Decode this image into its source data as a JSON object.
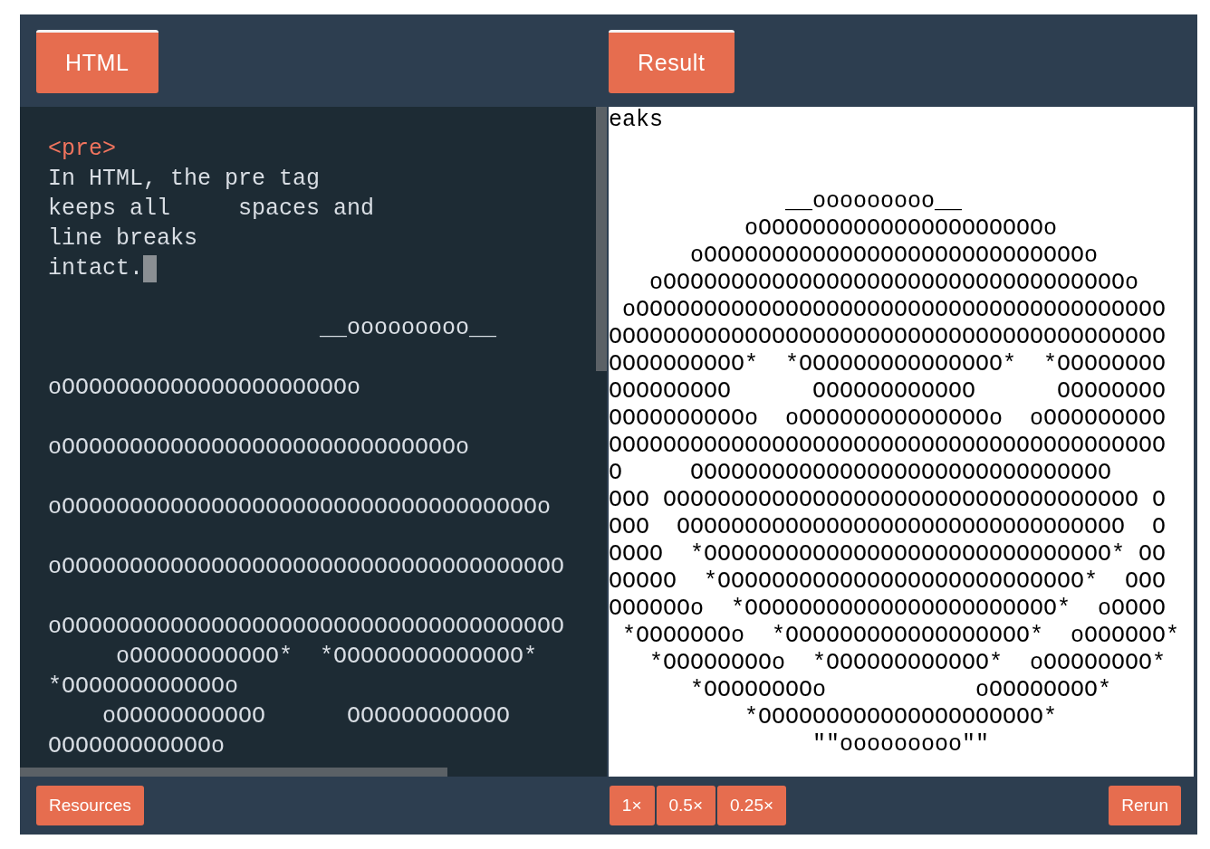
{
  "editor": {
    "tab": "HTML",
    "tag": "<pre>",
    "text": "In HTML, the pre tag\nkeeps all     spaces and\nline breaks\nintact.",
    "art": "                    __ooooooooo__\n\noOOOOOOOOOOOOOOOOOOOOOo\n\noOOOOOOOOOOOOOOOOOOOOOOOOOOOOOo\n\noOOOOOOOOOOOOOOOOOOOOOOOOOOOOOOOOOOOo\n\noOOOOOOOOOOOOOOOOOOOOOOOOOOOOOOOOOOOOO\n\noOOOOOOOOOOOOOOOOOOOOOOOOOOOOOOOOOOOOO\n     oOOOOOOOOOOO*  *OOOOOOOOOOOOOO*\n*OOOOOOOOOOOOo\n    oOOOOOOOOOOO      OOOOOOOOOOOO\nOOOOOOOOOOOOo"
  },
  "result": {
    "tab": "Result",
    "text": "eaks",
    "art": "             __ooooooooo__\n          oOOOOOOOOOOOOOOOOOOOOOo\n      oOOOOOOOOOOOOOOOOOOOOOOOOOOOOo\n   oOOOOOOOOOOOOOOOOOOOOOOOOOOOOOOOOOOo\n oOOOOOOOOOOOOOOOOOOOOOOOOOOOOOOOOOOOOOOO\nOOOOOOOOOOOOOOOOOOOOOOOOOOOOOOOOOOOOOOOOO\nOOOOOOOOOO*  *OOOOOOOOOOOOOOO*  *OOOOOOOO\nOOOOOOOOO      OOOOOOOOOOOO      OOOOOOOO\nOOOOOOOOOOo  oOOOOOOOOOOOOOOo  oOOOOOOOOO\nOOOOOOOOOOOOOOOOOOOOOOOOOOOOOOOOOOOOOOOOO\nO     OOOOOOOOOOOOOOOOOOOOOOOOOOOOOOO\nOOO OOOOOOOOOOOOOOOOOOOOOOOOOOOOOOOOOOO O\nOOO  OOOOOOOOOOOOOOOOOOOOOOOOOOOOOOOOO  O\nOOOO  *OOOOOOOOOOOOOOOOOOOOOOOOOOOOOO* OO\nOOOOO  *OOOOOOOOOOOOOOOOOOOOOOOOOOO*  OOO\nOOOOOOo  *OOOOOOOOOOOOOOOOOOOOOOO*  oOOOO\n *OOOOOOOo  *OOOOOOOOOOOOOOOOOO*  oOOOOOO*\n   *OOOOOOOOo  *OOOOOOOOOOOO*  oOOOOOOOO*\n      *OOOOOOOOo           oOOOOOOOO*\n          *OOOOOOOOOOOOOOOOOOOOO*\n               \"\"ooooooooo\"\""
  },
  "footer": {
    "resources": "Resources",
    "scales": [
      "1×",
      "0.5×",
      "0.25×"
    ],
    "rerun": "Rerun"
  }
}
